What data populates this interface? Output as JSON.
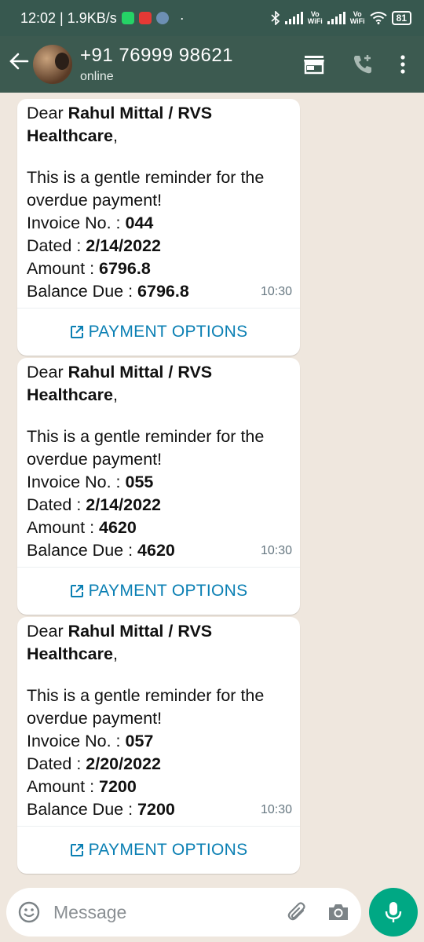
{
  "status_bar": {
    "time_speed": "12:02 | 1.9KB/s",
    "dot": "·",
    "vowifi_top": "Vo",
    "vowifi_bottom": "WiFi",
    "battery": "81"
  },
  "header": {
    "contact_name": "+91 76999 98621",
    "status": "online"
  },
  "messages": [
    {
      "greeting_prefix": "Dear ",
      "customer": "Rahul Mittal / RVS Healthcare",
      "greeting_suffix": ",",
      "reminder": "This is a gentle reminder for the overdue payment!",
      "invoice_label": "Invoice No. : ",
      "invoice_no": "044",
      "dated_label": "Dated : ",
      "dated": "2/14/2022",
      "amount_label": "Amount : ",
      "amount": "6796.8",
      "balance_label": "Balance Due : ",
      "balance": "6796.8",
      "time": "10:30",
      "action_label": "PAYMENT OPTIONS"
    },
    {
      "greeting_prefix": "Dear ",
      "customer": "Rahul Mittal / RVS Healthcare",
      "greeting_suffix": ",",
      "reminder": "This is a gentle reminder for the overdue payment!",
      "invoice_label": "Invoice No. : ",
      "invoice_no": "055",
      "dated_label": "Dated : ",
      "dated": "2/14/2022",
      "amount_label": "Amount : ",
      "amount": "4620",
      "balance_label": "Balance Due : ",
      "balance": "4620",
      "time": "10:30",
      "action_label": "PAYMENT OPTIONS"
    },
    {
      "greeting_prefix": "Dear ",
      "customer": "Rahul Mittal / RVS Healthcare",
      "greeting_suffix": ",",
      "reminder": "This is a gentle reminder for the overdue payment!",
      "invoice_label": "Invoice No. : ",
      "invoice_no": "057",
      "dated_label": "Dated : ",
      "dated": "2/20/2022",
      "amount_label": "Amount : ",
      "amount": "7200",
      "balance_label": "Balance Due : ",
      "balance": "7200",
      "time": "10:30",
      "action_label": "PAYMENT OPTIONS"
    }
  ],
  "composer": {
    "placeholder": "Message"
  },
  "colors": {
    "header_bg": "#3c5a50",
    "chat_bg": "#efe7de",
    "link": "#0a7fb3",
    "mic": "#00a884"
  },
  "icons": [
    "back-arrow-icon",
    "store-icon",
    "add-call-icon",
    "more-vert-icon",
    "emoji-icon",
    "attach-icon",
    "camera-icon",
    "mic-icon",
    "external-link-icon",
    "bluetooth-icon",
    "signal-icon",
    "wifi-icon",
    "battery-icon"
  ]
}
